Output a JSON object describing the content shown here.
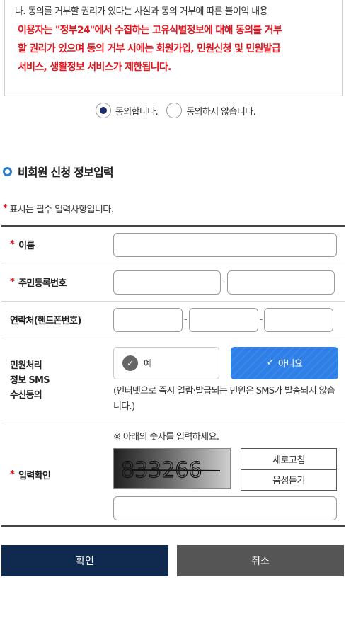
{
  "consent": {
    "heading": "나. 동의를 거부할 권리가 있다는 사실과 동의 거부에 따른 불이익 내용",
    "warning_lines": [
      "이용자는 \"정부24\"에서 수집하는 고유식별정보에 대해 동의를 거부",
      "할 권리가 있으며 동의 거부 시에는 회원가입, 민원신청 및 민원발급",
      "서비스, 생활정보 서비스가 제한됩니다."
    ],
    "agree_label": "동의합니다.",
    "disagree_label": "동의하지 않습니다.",
    "selected": "agree"
  },
  "section": {
    "title": "비회원 신청 정보입력",
    "required_note": "표시는 필수 입력사항입니다.",
    "required_mark": "*"
  },
  "form": {
    "name_label": "이름",
    "rrn_label": "주민등록번호",
    "phone_label": "연락처(핸드폰번호)",
    "dash": "-",
    "sms_label_lines": [
      "민원처리",
      "정보 SMS",
      "수신동의"
    ],
    "sms_yes": "예",
    "sms_no": "아니요",
    "sms_note": "(인터넷으로 즉시 열람·발급되는 민원은 SMS가 발송되지 않습니다.)",
    "captcha_label": "입력확인",
    "captcha_note": "※ 아래의 숫자를 입력하세요.",
    "captcha_code": "833266",
    "refresh_label": "새로고침",
    "audio_label": "음성듣기"
  },
  "buttons": {
    "confirm": "확인",
    "cancel": "취소"
  },
  "colors": {
    "required": "#e0161f",
    "primary": "#10294e",
    "selected_toggle": "#2f7fe6",
    "section_icon": "#2a7fd4"
  }
}
